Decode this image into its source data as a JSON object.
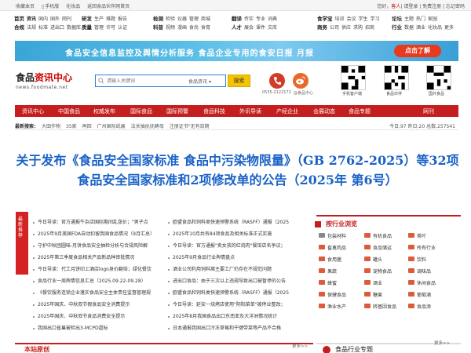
{
  "topbar": {
    "left": [
      "收藏本页",
      "手机版",
      "化妆品",
      "返回食品伙伴网首页"
    ],
    "right_pre": "您好，",
    "guest": "客人",
    "right_post": "| 请登录 | 免费注册 | 忘记密码"
  },
  "categories": [
    {
      "title": "首页",
      "items": [
        "资讯",
        "国内",
        "国外",
        "网刊"
      ],
      "title2": "合规",
      "items2": [
        "法规",
        "标准",
        "进出口",
        "数据库"
      ],
      "bold_first_row": [
        "首页",
        "资讯"
      ]
    },
    {
      "title": "研发",
      "items": [
        "生产",
        "难题",
        "报告"
      ],
      "title2": "质量",
      "items2": [
        "管理",
        "许可",
        "认证"
      ]
    },
    {
      "title": "检测",
      "items": [
        "检验",
        "仪器",
        "管理",
        "商城"
      ],
      "title2": "科普",
      "items2": [
        "视频",
        "漫画",
        "食尚",
        "食育"
      ]
    },
    {
      "title": "翻译",
      "items": [
        "传实",
        "专业",
        "词典"
      ],
      "title2": "人才",
      "items2": [
        "展会",
        "课件",
        "文库"
      ]
    },
    {
      "title": "食学宝",
      "items": [
        "培训",
        "会议",
        "学生",
        "学习"
      ],
      "title2": "商务",
      "items2": [
        "公司",
        "供应",
        "求购",
        "招商"
      ]
    },
    {
      "title": "论坛",
      "items": [
        "主题",
        "热门",
        "家园"
      ],
      "title2": "行业",
      "items2": [
        "数据",
        "酒业",
        "化妆品",
        "更多"
      ]
    }
  ],
  "banner": {
    "text": "食品安全信息监控及舆情分析服务    食品企业专用的食安日报  月报",
    "button": "点击了解"
  },
  "logo": {
    "main1": "食品",
    "main2": "资讯中心",
    "sub": "news.foodmate.net"
  },
  "search": {
    "placeholder": "请输入关键词",
    "select": "食品资讯",
    "button": "搜索"
  },
  "contact": {
    "phone": "0535-2122172",
    "weibo": "@食品中心"
  },
  "qrcodes": [
    "手机客户端",
    "食品伙伴",
    "国外食品"
  ],
  "nav": [
    "资讯中心",
    "中国食品",
    "权威发布",
    "国际食品",
    "国际预警",
    "食品科技",
    "外讯导读",
    "产经企业",
    "会展动态",
    "食品专题",
    "食品专题",
    "网刊"
  ],
  "hot": {
    "label": "最新搜索：",
    "items": [
      "大田作物",
      "35家",
      "再回",
      "广州国际纸展",
      "法关抽抚抚酵母",
      "注册证书\"无有效期"
    ],
    "right": "今日:97 昨日:20  总数:257541"
  },
  "headline": "关于发布《食品安全国家标准 食品中污染物限量》（GB 2762-2025）等32项食品安全国家标准和2项修改单的公告（2025年 第6号）",
  "promo": "最新推荐",
  "news_left": [
    "今日导读：官方通报牛杂店国际期间乱涨价；\"男子点",
    "2025年9月美国FDA自动扣留我国食品情况（9月汇总）",
    "守护中秋团圆味-月饼食品安全抽检分析与合规风险解",
    "2025年第三季度食品相关产品新品种审批情况",
    "今日导读：代工月饼印上酒店logo身价翻倍；绿化餐饮",
    "食品行业一周舆情信息汇总（2025.09.22-09.28）",
    "《餐饮服务连锁企业落实食品安全主体责任监督管理规",
    "2025年国庆、中秋双节假食品安全消费提示",
    "2025年国庆、中秋双节食品消费安全提示",
    "我国出口雀巢被检出3-MCPD超标"
  ],
  "news_right": [
    "欧盟食品和饲料类快速预警系统（RASFF）通报（2025",
    "2025年10月共有84项食品及相关标准正式实施",
    "今日导读：官方通报\"卖女孩的红烧肉\"餐馆店名争议；",
    "2025年9月食品行业舆情盘点",
    "酒业公司利用饲料窝主要工厂仍存在不规范问题",
    "进出口食品：由于三次以上违规导致出口被暂停的公告",
    "欧盟食品和饲料类快速预警系统（RASFF）通报（2025",
    "今日导读：延安一烧烤店使用\"阴阳菜单\"被停业整改；",
    "2025年8月我国食品出口东南亚及大洋洲情况统计",
    "日本通报我国出口冷冻草莓和干键带菜等产品不合格"
  ],
  "sidebar": {
    "title": "按行业浏览",
    "items": [
      [
        "包装材料",
        "有机食品",
        "茶叶"
      ],
      [
        "畜禽肉品",
        "食品储运",
        "所有行业"
      ],
      [
        "食用菌",
        "罐头",
        "饮料"
      ],
      [
        "果蔬",
        "宠物食品",
        "调味品"
      ],
      [
        "蜂蜜",
        "酒业",
        "休闲食品"
      ],
      [
        "保健食品",
        "糖果",
        "葡萄酒"
      ],
      [
        "渔业水产",
        "转基因食品",
        "食品添"
      ]
    ]
  },
  "bottom": {
    "left_title": "本站原创",
    "left_more": "更多>>",
    "right_title": "食品行业专题",
    "right_more": "更多>>"
  }
}
